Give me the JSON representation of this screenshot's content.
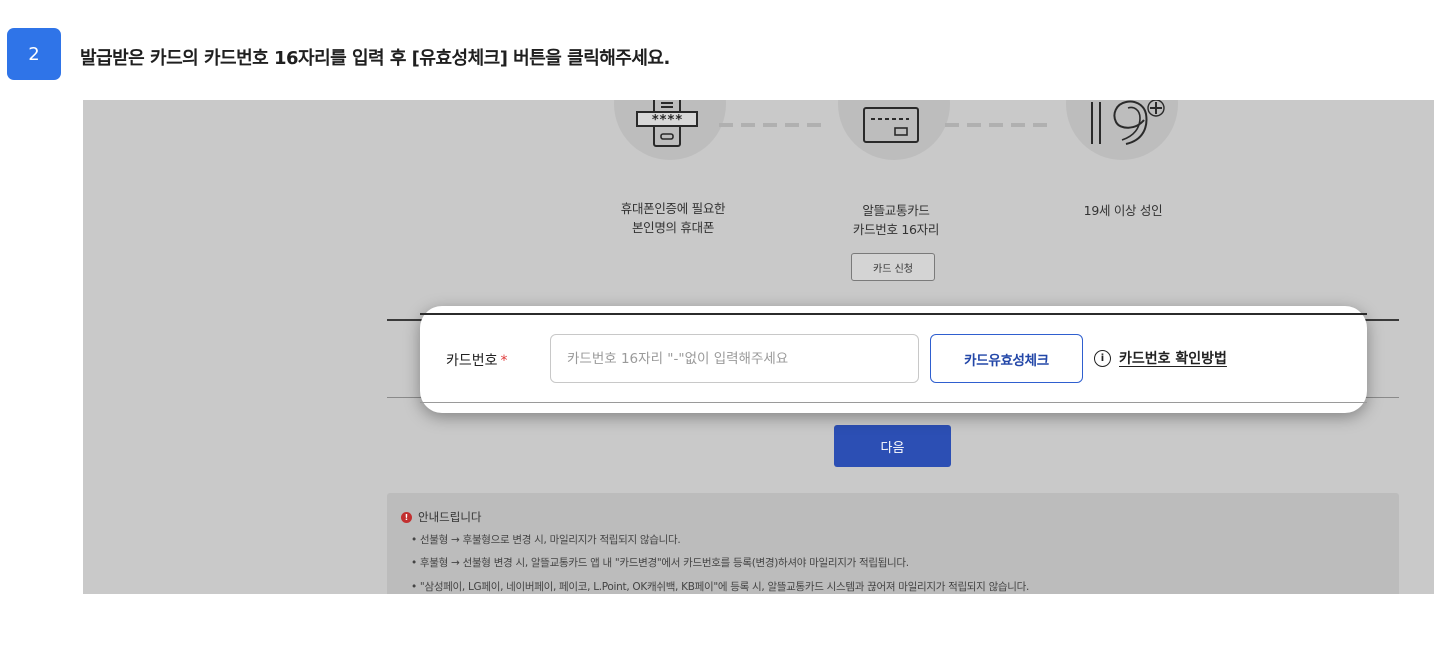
{
  "step": {
    "number": "2",
    "instruction": "발급받은 카드의 카드번호 16자리를 입력 후 [유효성체크] 버튼을 클릭해주세요."
  },
  "requirements": [
    {
      "icon": "phone-password-icon",
      "line1": "휴대폰인증에 필요한",
      "line2": "본인명의 휴대폰"
    },
    {
      "icon": "card-icon",
      "line1": "알뜰교통카드",
      "line2": "카드번호 16자리"
    },
    {
      "icon": "age-19-plus-icon",
      "line1": "19세 이상 성인",
      "line2": ""
    }
  ],
  "card_apply_label": "카드 신청",
  "form": {
    "card_number_label": "카드번호",
    "required_mark": "*",
    "card_number_placeholder": "카드번호 16자리 \"-\"없이 입력해주세요",
    "card_number_value": "",
    "validity_check_label": "카드유효성체크",
    "help_link_label": "카드번호 확인방법"
  },
  "next_label": "다음",
  "notice": {
    "title": "안내드립니다",
    "items": [
      "• 선불형 → 후불형으로 변경 시, 마일리지가 적립되지 않습니다.",
      "• 후불형 → 선불형 변경 시, 알뜰교통카드 앱 내 \"카드변경\"에서 카드번호를 등록(변경)하셔야 마일리지가 적립됩니다.",
      "• \"삼성페이, LG페이, 네이버페이, 페이코, L.Point, OK캐쉬백, KB페이\"에 등록 시, 알뜰교통카드 시스템과 끊어져 마일리지가 적립되지 않습니다."
    ]
  },
  "colors": {
    "badge": "#2f74e8",
    "next_button": "#2c4fb4",
    "check_button_border": "#2f5fcf",
    "required": "#e03a3a"
  }
}
